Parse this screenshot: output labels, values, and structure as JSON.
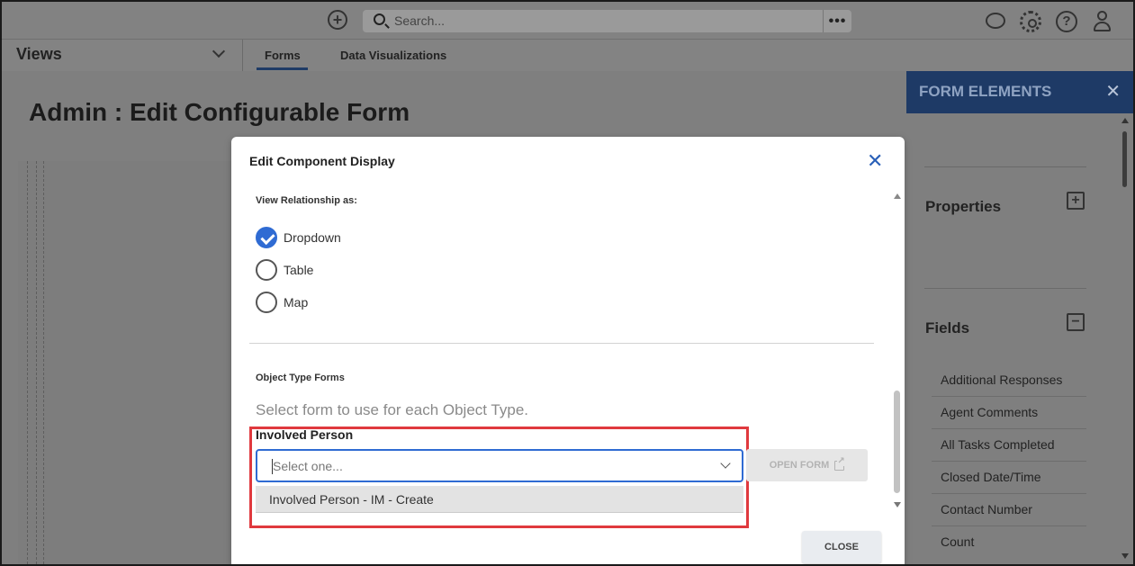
{
  "topbar": {
    "search_placeholder": "Search..."
  },
  "nav": {
    "views_label": "Views",
    "tabs": [
      {
        "label": "Forms",
        "active": true
      },
      {
        "label": "Data Visualizations",
        "active": false
      }
    ]
  },
  "page": {
    "title": "Admin : Edit Configurable Form"
  },
  "right_panel": {
    "title": "FORM ELEMENTS",
    "sections": [
      {
        "label": "Properties",
        "toggle": "+"
      },
      {
        "label": "Fields",
        "toggle": "−"
      }
    ],
    "fields": [
      "Additional Responses",
      "Agent Comments",
      "All Tasks Completed",
      "Closed Date/Time",
      "Contact Number",
      "Count"
    ]
  },
  "modal": {
    "title": "Edit Component Display",
    "view_relationship_label": "View Relationship as:",
    "options": [
      {
        "label": "Dropdown",
        "checked": true
      },
      {
        "label": "Table",
        "checked": false
      },
      {
        "label": "Map",
        "checked": false
      }
    ],
    "object_type_forms_label": "Object Type Forms",
    "helper_text": "Select form to use for each Object Type.",
    "field_label": "Involved Person",
    "select_placeholder": "Select one...",
    "dropdown_option": "Involved Person - IM - Create",
    "open_form_label": "OPEN FORM",
    "close_label": "CLOSE"
  },
  "colors": {
    "accent": "#2f6bd3",
    "panel_header": "#1e3a66",
    "highlight": "#e0393e"
  }
}
